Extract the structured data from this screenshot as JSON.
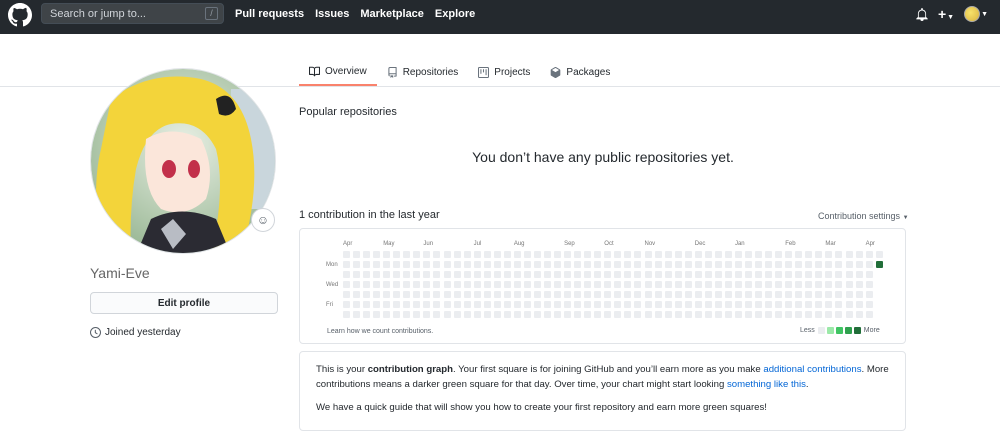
{
  "header": {
    "search_placeholder": "Search or jump to...",
    "search_shortcut": "/",
    "nav": [
      "Pull requests",
      "Issues",
      "Marketplace",
      "Explore"
    ],
    "plus_label": "+"
  },
  "tabs": [
    {
      "label": "Overview",
      "icon": "book-icon"
    },
    {
      "label": "Repositories",
      "icon": "repo-icon"
    },
    {
      "label": "Projects",
      "icon": "project-icon"
    },
    {
      "label": "Packages",
      "icon": "package-icon"
    }
  ],
  "profile": {
    "username": "Yami-Eve",
    "edit_label": "Edit profile",
    "joined": "Joined yesterday"
  },
  "main": {
    "popular_title": "Popular repositories",
    "no_repos": "You don’t have any public repositories yet.",
    "contrib_title": "1 contribution in the last year",
    "contrib_settings": "Contribution settings",
    "months": [
      "Apr",
      "May",
      "Jun",
      "Jul",
      "Aug",
      "Sep",
      "Oct",
      "Nov",
      "Dec",
      "Jan",
      "Feb",
      "Mar",
      "Apr"
    ],
    "days": [
      "Mon",
      "Wed",
      "Fri"
    ],
    "learn": "Learn how we count contributions.",
    "legend_less": "Less",
    "legend_more": "More",
    "colors": [
      "#ebedf0",
      "#9be9a8",
      "#40c463",
      "#30a14e",
      "#216e39"
    ],
    "contributions": [
      {
        "week": 53,
        "weekday": 1,
        "level": 4
      }
    ]
  },
  "info": {
    "p1_a": "This is your ",
    "p1_b": "contribution graph",
    "p1_c": ". Your first square is for joining GitHub and you’ll earn more as you make ",
    "p1_link1": "additional contributions",
    "p1_d": ". More contributions means a darker green square for that day. Over time, your chart might start looking ",
    "p1_link2": "something like this",
    "p1_e": ".",
    "p2": "We have a quick guide that will show you how to create your first repository and earn more green squares!"
  }
}
